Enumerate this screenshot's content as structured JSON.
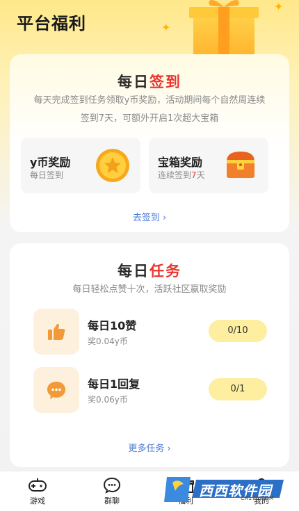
{
  "header": {
    "title": "平台福利"
  },
  "signin": {
    "title_dark": "每日",
    "title_red": "签到",
    "desc_line1": "每天完成签到任务领取y币奖励，活动期间每个自然周连续",
    "desc_line2": "签到7天，可额外开启1次超大宝箱",
    "rewards": [
      {
        "name": "y币奖励",
        "sub": "每日签到",
        "icon": "coin-star-icon"
      },
      {
        "name": "宝箱奖励",
        "sub_prefix": "连续签到",
        "sub_highlight": "7",
        "sub_suffix": "天",
        "icon": "treasure-chest-icon"
      }
    ],
    "link": "去签到"
  },
  "tasks": {
    "title_dark": "每日",
    "title_red": "任务",
    "desc": "每日轻松点赞十次，活跃社区赢取奖励",
    "items": [
      {
        "name": "每日10赞",
        "reward": "奖0.04y币",
        "progress": "0/10",
        "icon": "thumbs-up-icon"
      },
      {
        "name": "每日1回复",
        "reward": "奖0.06y币",
        "progress": "0/1",
        "icon": "chat-bubble-icon"
      }
    ],
    "more_link": "更多任务"
  },
  "tabbar": {
    "items": [
      {
        "label": "游戏",
        "icon": "gamepad-icon"
      },
      {
        "label": "群聊",
        "icon": "chat-icon"
      },
      {
        "label": "福利",
        "icon": "gift-icon"
      },
      {
        "label": "我的",
        "icon": "user-icon"
      }
    ]
  },
  "watermark": {
    "text": "西西软件园",
    "sub": "CR173.COM"
  },
  "colors": {
    "accent_red": "#e8342e",
    "accent_yellow": "#fdeea0",
    "link_blue": "#4a7ad8"
  }
}
